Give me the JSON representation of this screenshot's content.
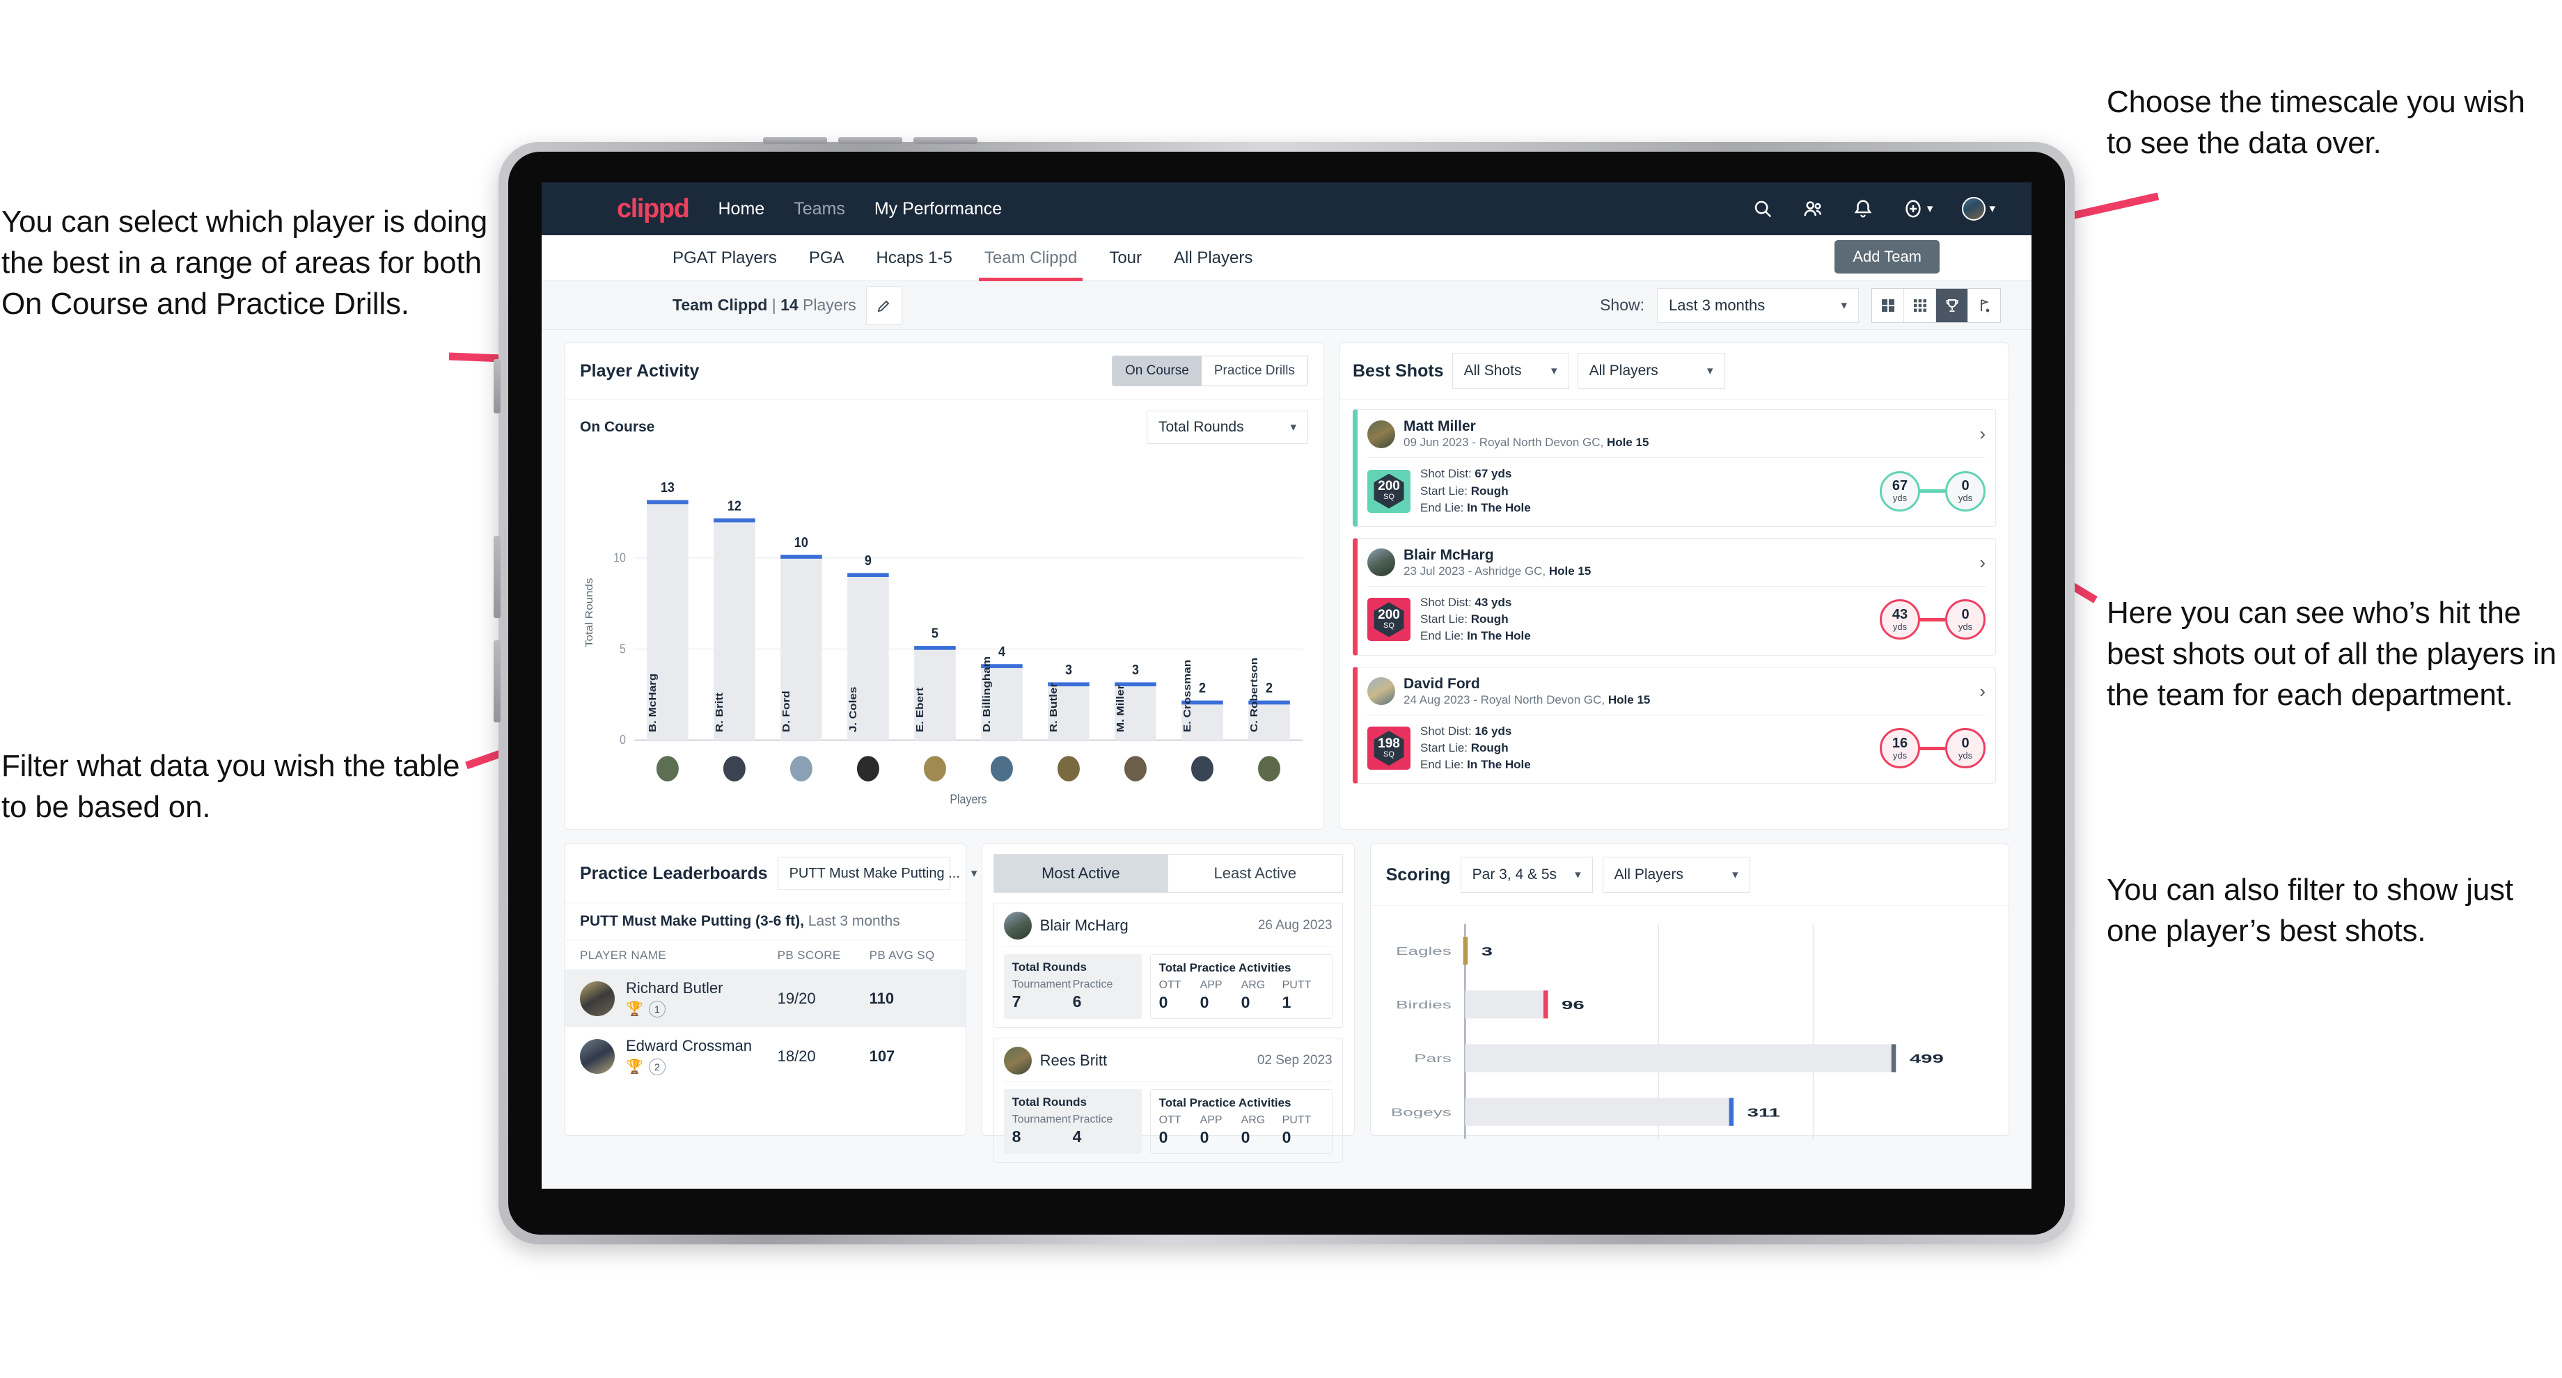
{
  "annotations": {
    "left_1": "You can select which player is doing the best in a range of areas for both On Course and Practice Drills.",
    "left_2": "Filter what data you wish the table to be based on.",
    "right_1": "Choose the timescale you wish to see the data over.",
    "right_2": "Here you can see who’s hit the best shots out of all the players in the team for each department.",
    "right_3": "You can also filter to show just one player’s best shots."
  },
  "topnav": {
    "brand": "clippd",
    "links": [
      {
        "label": "Home",
        "active": true
      },
      {
        "label": "Teams",
        "active": false
      },
      {
        "label": "My Performance",
        "active": true
      }
    ],
    "icons": [
      "search-icon",
      "people-icon",
      "bell-icon",
      "plus-circle-icon",
      "avatar"
    ]
  },
  "subnav": {
    "tabs": [
      {
        "label": "PGAT Players",
        "active": false
      },
      {
        "label": "PGA",
        "active": false
      },
      {
        "label": "Hcaps 1-5",
        "active": false
      },
      {
        "label": "Team Clippd",
        "active": true
      },
      {
        "label": "Tour",
        "active": false
      },
      {
        "label": "All Players",
        "active": false
      }
    ],
    "add_team": "Add Team"
  },
  "teambar": {
    "team_name": "Team Clippd",
    "divider": " | ",
    "player_count": "14",
    "players_word": " Players",
    "show_label": "Show:",
    "timescale": "Last 3 months",
    "view_buttons": [
      "grid-large-icon",
      "grid-small-icon",
      "trophy-icon",
      "flag-icon"
    ],
    "active_view": "trophy-icon"
  },
  "player_activity": {
    "title": "Player Activity",
    "segments": [
      {
        "label": "On Course",
        "active": true
      },
      {
        "label": "Practice Drills",
        "active": false
      }
    ],
    "sub_label": "On Course",
    "metric": "Total Rounds"
  },
  "chart_data": {
    "type": "bar",
    "title": "Player Activity — On Course",
    "xlabel": "Players",
    "ylabel": "Total Rounds",
    "ylim": [
      0,
      14
    ],
    "yticks": [
      0,
      5,
      10
    ],
    "grid": true,
    "categories": [
      "B. McHarg",
      "R. Britt",
      "D. Ford",
      "J. Coles",
      "E. Ebert",
      "D. Billingham",
      "R. Butler",
      "M. Miller",
      "E. Crossman",
      "C. Robertson"
    ],
    "values": [
      13,
      12,
      10,
      9,
      5,
      4,
      3,
      3,
      2,
      2
    ],
    "bar_color": "#e8eaed",
    "cap_color": "#3a6fd8"
  },
  "best_shots": {
    "title": "Best Shots",
    "filter_shots": "All Shots",
    "filter_players": "All Players",
    "shots": [
      {
        "player": "Matt Miller",
        "meta_prefix": "09 Jun 2023 - Royal North Devon GC, ",
        "hole": "Hole 15",
        "sq": "200",
        "sq_unit": "SQ",
        "accent": "teal",
        "shot_dist_label": "Shot Dist: ",
        "shot_dist": "67 yds",
        "start_lie_label": "Start Lie: ",
        "start_lie": "Rough",
        "end_lie_label": "End Lie: ",
        "end_lie": "In The Hole",
        "from_value": "67",
        "from_unit": "yds",
        "to_value": "0",
        "to_unit": "yds"
      },
      {
        "player": "Blair McHarg",
        "meta_prefix": "23 Jul 2023 - Ashridge GC, ",
        "hole": "Hole 15",
        "sq": "200",
        "sq_unit": "SQ",
        "accent": "pink",
        "shot_dist_label": "Shot Dist: ",
        "shot_dist": "43 yds",
        "start_lie_label": "Start Lie: ",
        "start_lie": "Rough",
        "end_lie_label": "End Lie: ",
        "end_lie": "In The Hole",
        "from_value": "43",
        "from_unit": "yds",
        "to_value": "0",
        "to_unit": "yds"
      },
      {
        "player": "David Ford",
        "meta_prefix": "24 Aug 2023 - Royal North Devon GC, ",
        "hole": "Hole 15",
        "sq": "198",
        "sq_unit": "SQ",
        "accent": "pink",
        "shot_dist_label": "Shot Dist: ",
        "shot_dist": "16 yds",
        "start_lie_label": "Start Lie: ",
        "start_lie": "Rough",
        "end_lie_label": "End Lie: ",
        "end_lie": "In The Hole",
        "from_value": "16",
        "from_unit": "yds",
        "to_value": "0",
        "to_unit": "yds"
      }
    ]
  },
  "practice_leaderboards": {
    "title": "Practice Leaderboards",
    "drill_select": "PUTT Must Make Putting ...",
    "subtitle_bold": "PUTT Must Make Putting (3-6 ft),",
    "subtitle_rest": " Last 3 months",
    "columns": [
      "PLAYER NAME",
      "PB SCORE",
      "PB AVG SQ"
    ],
    "rows": [
      {
        "name": "Richard Butler",
        "rank": "1",
        "trophy": "gold",
        "pb_score": "19/20",
        "pb_avg_sq": "110"
      },
      {
        "name": "Edward Crossman",
        "rank": "2",
        "trophy": "silver",
        "pb_score": "18/20",
        "pb_avg_sq": "107"
      }
    ]
  },
  "activity_panel": {
    "tabs": [
      {
        "label": "Most Active",
        "active": true
      },
      {
        "label": "Least Active",
        "active": false
      }
    ],
    "total_rounds_label": "Total Rounds",
    "total_practice_label": "Total Practice Activities",
    "rounds_keys": [
      "Tournament",
      "Practice"
    ],
    "practice_keys": [
      "OTT",
      "APP",
      "ARG",
      "PUTT"
    ],
    "cards": [
      {
        "player": "Blair McHarg",
        "date": "26 Aug 2023",
        "rounds": [
          "7",
          "6"
        ],
        "practice": [
          "0",
          "0",
          "0",
          "1"
        ]
      },
      {
        "player": "Rees Britt",
        "date": "02 Sep 2023",
        "rounds": [
          "8",
          "4"
        ],
        "practice": [
          "0",
          "0",
          "0",
          "0"
        ]
      }
    ]
  },
  "scoring": {
    "title": "Scoring",
    "filter_par": "Par 3, 4 & 5s",
    "filter_players": "All Players",
    "chart": {
      "type": "bar",
      "orientation": "horizontal",
      "categories": [
        "Eagles",
        "Birdies",
        "Pars",
        "Bogeys"
      ],
      "values": [
        3,
        96,
        499,
        311
      ],
      "xlim": [
        0,
        560
      ],
      "cap_colors": [
        "#b99a4b",
        "#ef4060",
        "#5c6b76",
        "#3a6fd8"
      ],
      "bar_color": "#e8eaed",
      "grid": true
    }
  }
}
